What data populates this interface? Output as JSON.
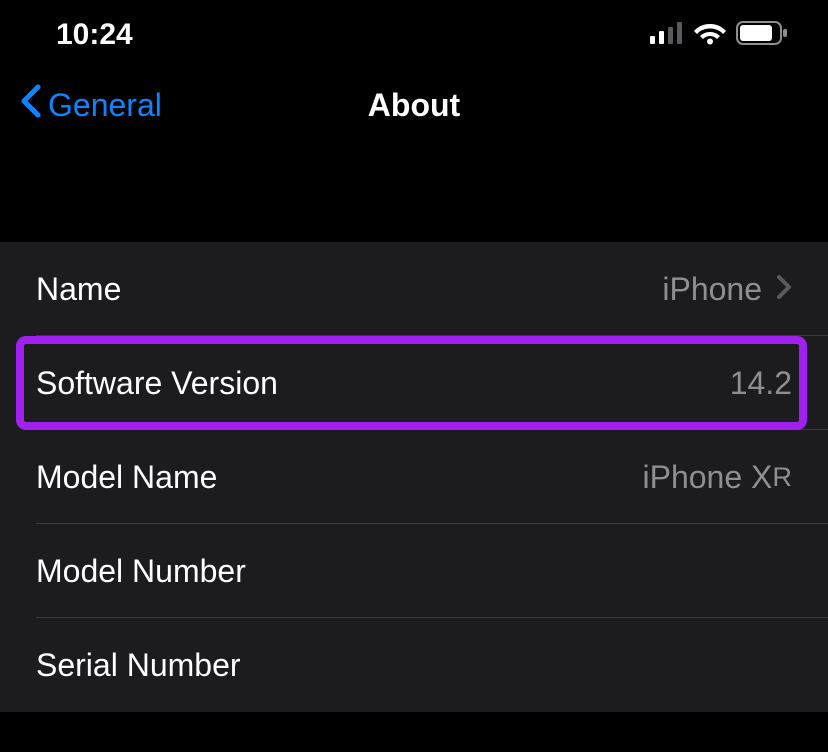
{
  "statusBar": {
    "time": "10:24"
  },
  "nav": {
    "backLabel": "General",
    "title": "About"
  },
  "rows": {
    "name": {
      "label": "Name",
      "value": "iPhone"
    },
    "softwareVersion": {
      "label": "Software Version",
      "value": "14.2"
    },
    "modelName": {
      "label": "Model Name",
      "value": "iPhone X",
      "valueSuffix": "R"
    },
    "modelNumber": {
      "label": "Model Number",
      "value": ""
    },
    "serialNumber": {
      "label": "Serial Number",
      "value": ""
    }
  }
}
